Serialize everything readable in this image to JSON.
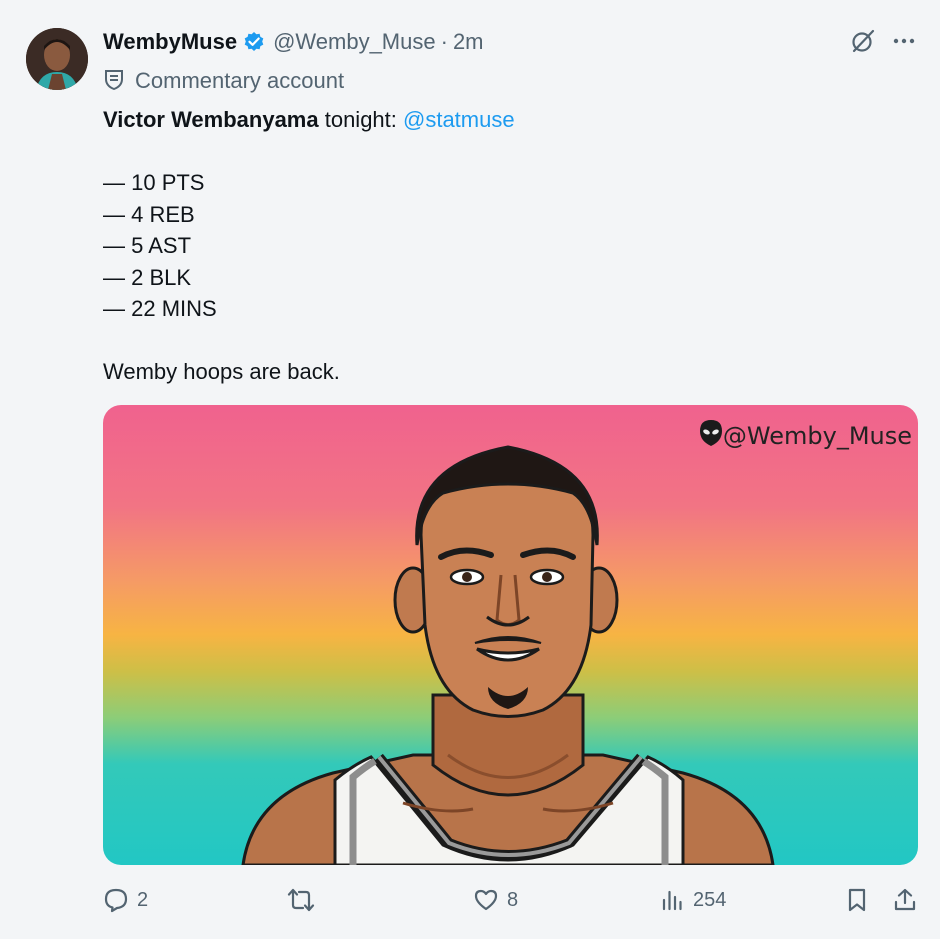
{
  "tweet": {
    "display_name": "WembyMuse",
    "handle": "@Wemby_Muse",
    "separator": "·",
    "time": "2m",
    "label": "Commentary account",
    "body": {
      "name_bold": "Victor Wembanyama",
      "text_after_name": " tonight: ",
      "mention": "@statmuse",
      "stats": [
        "— 10 PTS",
        "— 4 REB",
        "— 5 AST",
        "— 2 BLK",
        "— 22 MINS"
      ],
      "closing": "Wemby hoops are back."
    },
    "media": {
      "watermark": "@Wemby_Muse"
    },
    "actions": {
      "replies": "2",
      "retweets": "",
      "likes": "8",
      "views": "254"
    }
  },
  "colors": {
    "accent": "#1d9bf0",
    "secondary_text": "#536471",
    "background": "#f3f5f7"
  },
  "icons": [
    "verified-badge-icon",
    "grok-icon",
    "more-icon",
    "commentary-label-icon",
    "reply-icon",
    "retweet-icon",
    "like-icon",
    "views-icon",
    "bookmark-icon",
    "share-icon",
    "alien-icon"
  ]
}
